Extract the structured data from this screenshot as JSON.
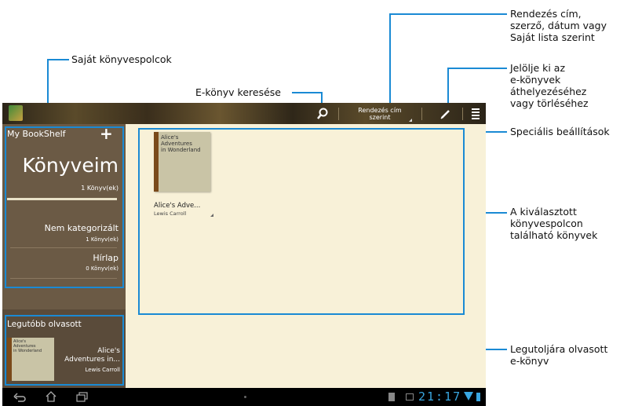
{
  "callouts": {
    "my_bookshelves": "Saját könyvespolcok",
    "ebook_search": "E-könyv keresése",
    "sort_by": "Rendezés cím,\nszerző, dátum vagy\nSaját lista szerint",
    "select_move_delete": "Jelölje ki az\ne-könyvek\náthelyezéséhez\nvagy törléséhez",
    "special_settings": "Speciális beállítások",
    "books_on_shelf": "A kiválasztott\nkönyvespolcon\ntalálható könyvek",
    "last_read": "Legutoljára olvasott\ne-könyv"
  },
  "topbar": {
    "sort_label": "Rendezés cím\nszerint"
  },
  "sidebar": {
    "header": "My BookShelf",
    "add_symbol": "+",
    "main_shelf": {
      "title": "Könyveim",
      "count": "1 Könyv(ek)"
    },
    "shelves": [
      {
        "title": "Nem kategorizált",
        "count": "1 Könyv(ek)"
      },
      {
        "title": "Hírlap",
        "count": "0 Könyv(ek)"
      }
    ],
    "recent_header": "Legutóbb olvasott",
    "recent_book": {
      "title": "Alice's\nAdventures in...",
      "author": "Lewis Carroll",
      "cover_text": "Alice's\nAdventures\nin Wonderland"
    }
  },
  "content": {
    "books": [
      {
        "cover_text": "Alice's\nAdventures\nin Wonderland",
        "title": "Alice's Adve...",
        "author": "Lewis Carroll"
      }
    ]
  },
  "statusbar": {
    "time": "21:17"
  },
  "colors": {
    "callout": "#1a8ad4",
    "sidebar": "#6b5a45",
    "content_bg": "#f8f1d8"
  }
}
